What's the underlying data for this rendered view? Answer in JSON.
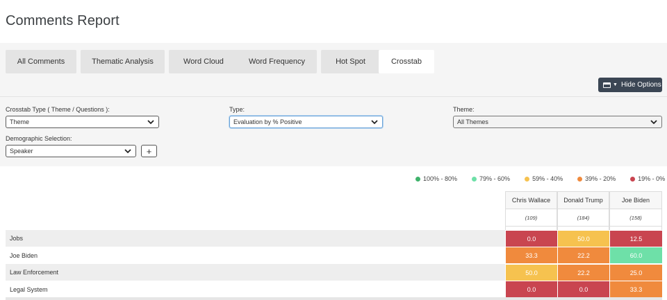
{
  "page": {
    "title": "Comments Report"
  },
  "tabs": [
    {
      "label": "All Comments",
      "active": false
    },
    {
      "label": "Thematic Analysis",
      "active": false
    },
    {
      "label": "Word Cloud",
      "active": false
    },
    {
      "label": "Word Frequency",
      "active": false
    },
    {
      "label": "Hot Spot",
      "active": false
    },
    {
      "label": "Crosstab",
      "active": true
    }
  ],
  "options": {
    "hide_label": "Hide Options",
    "crosstab_type": {
      "label": "Crosstab Type ( Theme / Questions ):",
      "value": "Theme"
    },
    "type": {
      "label": "Type:",
      "value": "Evaluation by % Positive"
    },
    "theme": {
      "label": "Theme:",
      "value": "All Themes"
    },
    "demographic": {
      "label": "Demographic Selection:",
      "value": "Speaker"
    },
    "add_label": "+"
  },
  "legend": [
    {
      "label": "100% - 80%",
      "color": "#3fb26b"
    },
    {
      "label": "79% - 60%",
      "color": "#6ee0a8"
    },
    {
      "label": "59% - 40%",
      "color": "#f6c24f"
    },
    {
      "label": "39% - 20%",
      "color": "#f08a3d"
    },
    {
      "label": "19% - 0%",
      "color": "#c94550"
    }
  ],
  "columns": [
    {
      "name": "Chris Wallace",
      "count": "(109)"
    },
    {
      "name": "Donald Trump",
      "count": "(184)"
    },
    {
      "name": "Joe Biden",
      "count": "(158)"
    }
  ],
  "rows": [
    {
      "label": "Jobs",
      "values": [
        "0.0",
        "50.0",
        "12.5"
      ],
      "colors": [
        "#c94550",
        "#f6c24f",
        "#c94550"
      ]
    },
    {
      "label": "Joe Biden",
      "values": [
        "33.3",
        "22.2",
        "60.0"
      ],
      "colors": [
        "#f08a3d",
        "#f08a3d",
        "#6ee0a8"
      ]
    },
    {
      "label": "Law Enforcement",
      "values": [
        "50.0",
        "22.2",
        "25.0"
      ],
      "colors": [
        "#f6c24f",
        "#f08a3d",
        "#f08a3d"
      ]
    },
    {
      "label": "Legal System",
      "values": [
        "0.0",
        "0.0",
        "33.3"
      ],
      "colors": [
        "#c94550",
        "#c94550",
        "#f08a3d"
      ]
    }
  ]
}
